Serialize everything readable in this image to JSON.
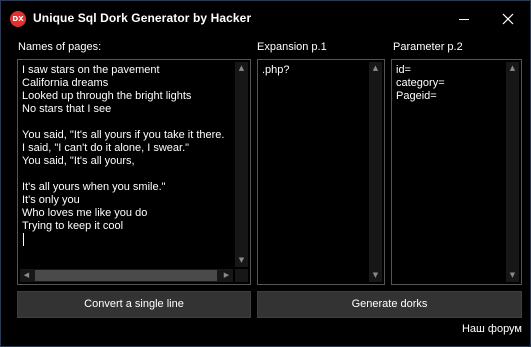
{
  "window": {
    "title": "Unique Sql Dork Generator by Hacker",
    "icon_text": "DX",
    "icon_color": "#e0312f"
  },
  "pages": {
    "label": "Names of pages:",
    "lines": [
      "I saw stars on the pavement",
      "California dreams",
      "Looked up through the bright lights",
      "No stars that I see",
      "",
      "You said, \"It's all yours if you take it there.",
      "I said, \"I can't do it alone, I swear.\"",
      "You said, \"It's all yours,",
      "",
      "It's all yours when you smile.\"",
      "It's only you",
      "Who loves me like you do",
      "Trying to keep it cool"
    ]
  },
  "expansion": {
    "label": "Expansion p.1",
    "lines": [
      ".php?"
    ]
  },
  "parameter": {
    "label": "Parameter p.2",
    "lines": [
      "id=",
      "category=",
      "Pageid="
    ]
  },
  "buttons": {
    "convert": "Convert a single line",
    "generate": "Generate dorks"
  },
  "footer": {
    "forum_link": "Наш форум"
  }
}
